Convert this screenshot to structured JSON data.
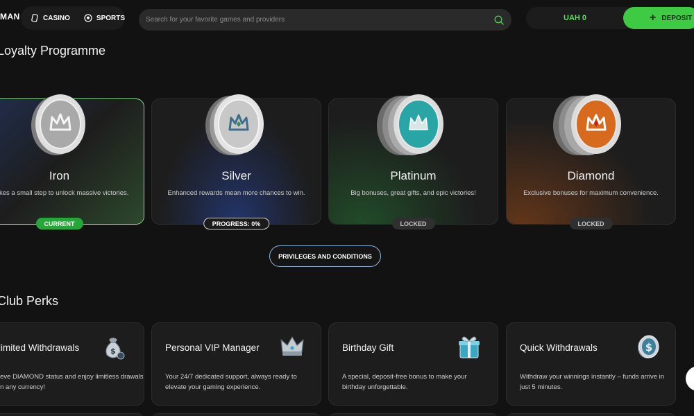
{
  "header": {
    "logo": "MAN",
    "tabs": [
      {
        "label": "CASINO",
        "icon": "casino-icon"
      },
      {
        "label": "SPORTS",
        "icon": "sports-ball-icon"
      }
    ],
    "search_placeholder": "Search for your favorite games and providers",
    "balance": "UAH 0",
    "deposit_label": "DEPOSIT"
  },
  "loyalty": {
    "title": "Loyalty Programme",
    "cards": [
      {
        "name": "Iron",
        "desc": "kes a small step to unlock massive victories.",
        "badge": "CURRENT"
      },
      {
        "name": "Silver",
        "desc": "Enhanced rewards mean more chances to win.",
        "badge": "PROGRESS: 0%"
      },
      {
        "name": "Platinum",
        "desc": "Big bonuses, great gifts, and epic victories!",
        "badge": "LOCKED"
      },
      {
        "name": "Diamond",
        "desc": "Exclusive bonuses for maximum convenience.",
        "badge": "LOCKED"
      }
    ],
    "privileges_label": "PRIVILEGES AND CONDITIONS"
  },
  "perks": {
    "title": "Club Perks",
    "items": [
      {
        "title": "limited Withdrawals",
        "desc": "ieve DIAMOND status and enjoy limitless drawals in any currency!",
        "icon": "money-bag-icon"
      },
      {
        "title": "Personal VIP Manager",
        "desc": "Your 24/7 dedicated support, always ready to elevate your gaming experience.",
        "icon": "crown-icon"
      },
      {
        "title": "Birthday Gift",
        "desc": "A special, deposit-free bonus to make your birthday unforgettable.",
        "icon": "gift-box-icon"
      },
      {
        "title": "Quick Withdrawals",
        "desc": "Withdraw your winnings instantly – funds arrive in just 5 minutes.",
        "icon": "dollar-coin-icon"
      }
    ]
  },
  "colors": {
    "accent_green": "#3ecb43",
    "balance_green": "#5fdc63",
    "background": "#121212",
    "card": "#1d1d1d"
  }
}
